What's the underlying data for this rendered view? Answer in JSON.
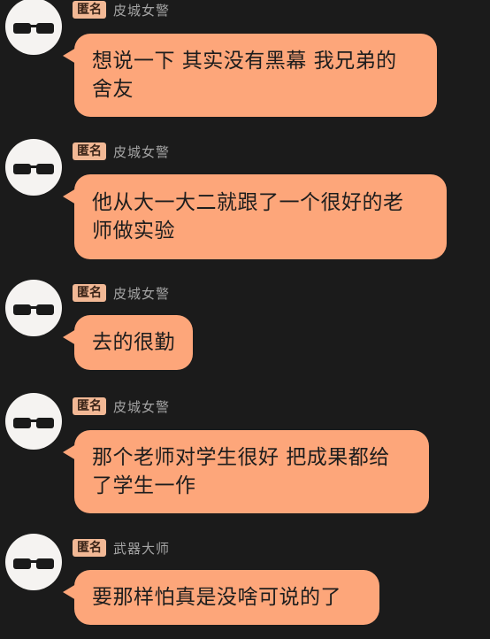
{
  "messages": [
    {
      "badge": "匿名",
      "nickname": "皮城女警",
      "lines": [
        "想说一下 其实没有黑幕 我兄弟的",
        "舍友"
      ],
      "avatar_icon": "cat-sunglasses-icon"
    },
    {
      "badge": "匿名",
      "nickname": "皮城女警",
      "lines": [
        "他从大一大二就跟了一个很好的老",
        "师做实验"
      ],
      "avatar_icon": "cat-sunglasses-icon"
    },
    {
      "badge": "匿名",
      "nickname": "皮城女警",
      "lines": [
        "去的很勤"
      ],
      "avatar_icon": "cat-sunglasses-icon"
    },
    {
      "badge": "匿名",
      "nickname": "皮城女警",
      "lines": [
        "那个老师对学生很好 把成果都给",
        "了学生一作"
      ],
      "avatar_icon": "cat-sunglasses-icon"
    },
    {
      "badge": "匿名",
      "nickname": "武器大师",
      "lines": [
        "要那样怕真是没啥可说的了"
      ],
      "avatar_icon": "cat-sunglasses-icon"
    }
  ],
  "colors": {
    "background": "#1b1b1b",
    "bubble": "#fda67a",
    "badge": "#f2b895",
    "nickname": "#a4a4a4",
    "text": "#1d1d1d"
  }
}
